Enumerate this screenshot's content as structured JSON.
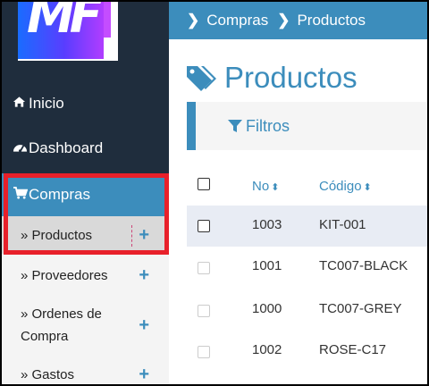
{
  "logo": {
    "text": "MF"
  },
  "sidebar": {
    "items": [
      {
        "label": "Inicio",
        "icon": "home-icon"
      },
      {
        "label": "Dashboard",
        "icon": "dashboard-icon"
      },
      {
        "label": "Compras",
        "icon": "cart-icon"
      }
    ],
    "submenu": [
      {
        "label": "» Productos",
        "selected": true
      },
      {
        "label": "» Proveedores"
      },
      {
        "label_line1": "» Ordenes de",
        "label_line2": "Compra"
      },
      {
        "label": "» Gastos"
      }
    ],
    "plus": "+"
  },
  "breadcrumb": {
    "items": [
      "Compras",
      "Productos"
    ],
    "chevron": "❯"
  },
  "page": {
    "title": "Productos"
  },
  "filters": {
    "label": "Filtros"
  },
  "table": {
    "headers": {
      "no": "No",
      "codigo": "Código"
    },
    "sort_glyph": "⬍",
    "rows": [
      {
        "no": "1003",
        "codigo": "KIT-001"
      },
      {
        "no": "1001",
        "codigo": "TC007-BLACK"
      },
      {
        "no": "1000",
        "codigo": "TC007-GREY"
      },
      {
        "no": "1002",
        "codigo": "ROSE-C17"
      }
    ]
  },
  "colors": {
    "accent": "#3c8dbc",
    "sidebar": "#1f2d3d",
    "highlight": "#e8202a"
  }
}
